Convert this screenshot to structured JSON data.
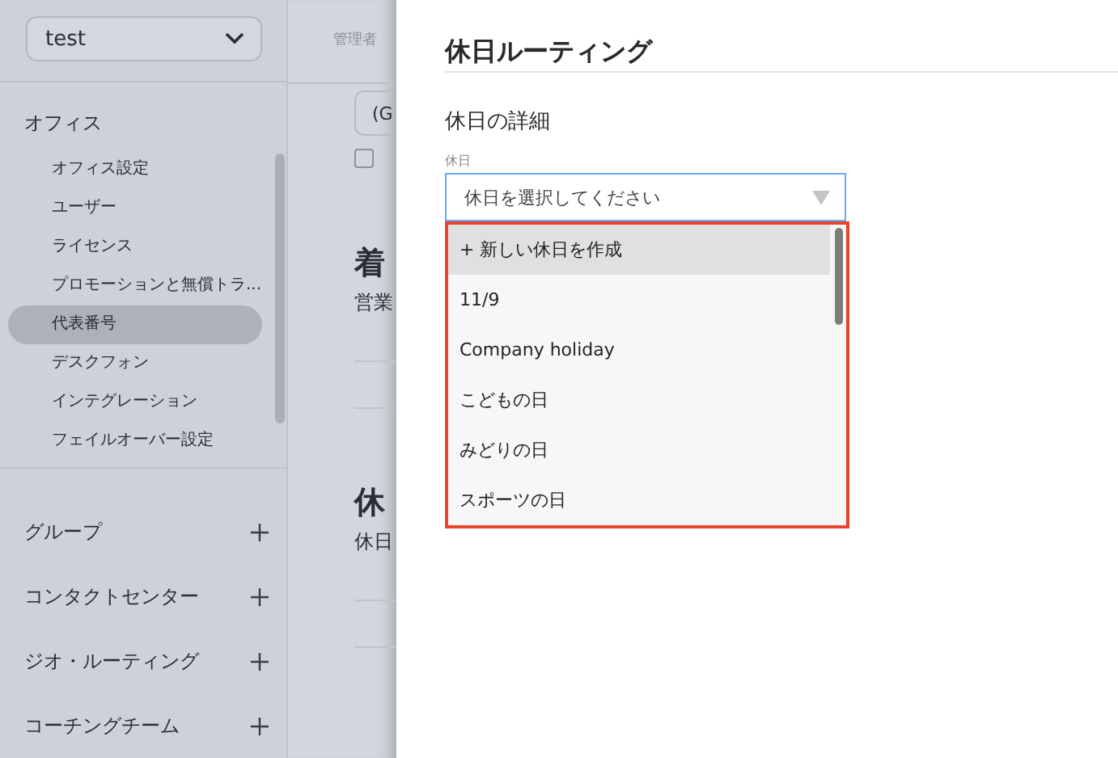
{
  "workspace_select": {
    "value": "test"
  },
  "sidebar": {
    "section": "オフィス",
    "items": [
      {
        "label": "オフィス設定",
        "selected": false
      },
      {
        "label": "ユーザー",
        "selected": false
      },
      {
        "label": "ライセンス",
        "selected": false
      },
      {
        "label": "プロモーションと無償トラ...",
        "selected": false
      },
      {
        "label": "代表番号",
        "selected": true
      },
      {
        "label": "デスクフォン",
        "selected": false
      },
      {
        "label": "インテグレーション",
        "selected": false
      },
      {
        "label": "フェイルオーバー設定",
        "selected": false
      }
    ],
    "groups": [
      {
        "label": "グループ"
      },
      {
        "label": "コンタクトセンター"
      },
      {
        "label": "ジオ・ルーティング"
      },
      {
        "label": "コーチングチーム"
      }
    ]
  },
  "background_page": {
    "breadcrumb": "管理者",
    "field_value": "(G",
    "checkbox": {
      "checked": false
    },
    "texts": [
      {
        "kind": "heading",
        "text": "着"
      },
      {
        "kind": "body",
        "text": "営業"
      },
      {
        "kind": "heading",
        "text": "休"
      },
      {
        "kind": "body",
        "text": "休日"
      }
    ]
  },
  "panel": {
    "title": "休日ルーティング",
    "section": "休日の詳細",
    "field_label": "休日",
    "select": {
      "placeholder": "休日を選択してください",
      "expanded": true
    },
    "options": [
      {
        "label": "+ 新しい休日を作成",
        "highlighted": true
      },
      {
        "label": "11/9",
        "highlighted": false
      },
      {
        "label": "Company holiday",
        "highlighted": false
      },
      {
        "label": "こどもの日",
        "highlighted": false
      },
      {
        "label": "みどりの日",
        "highlighted": false
      },
      {
        "label": "スポーツの日",
        "highlighted": false
      }
    ]
  }
}
